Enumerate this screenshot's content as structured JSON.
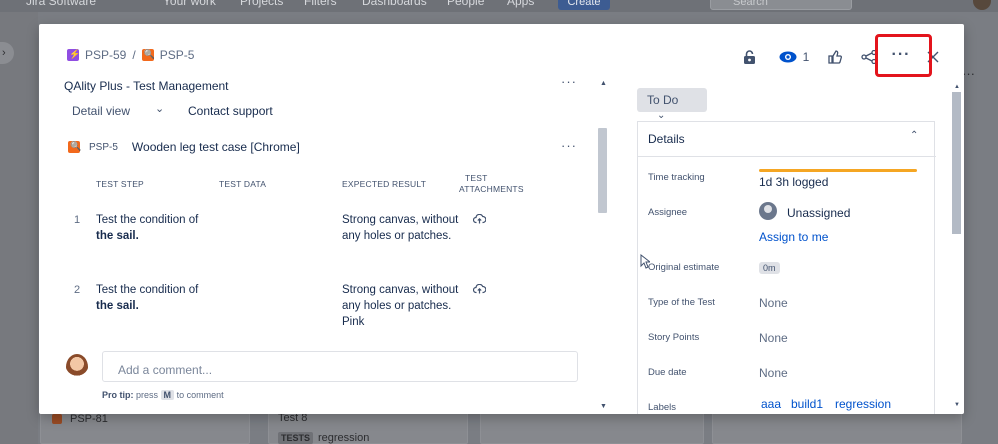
{
  "background": {
    "nav_items": [
      "Your work",
      "Projects",
      "Filters",
      "Dashboards",
      "People",
      "Apps"
    ],
    "app_name": "Jira Software",
    "create_label": "Create",
    "search_placeholder": "Search",
    "bottom_left_key": "PSP-81",
    "bottom_mid_text": "Test 8",
    "bottom_mid_tag": "TESTS",
    "bottom_mid_tag_value": "regression"
  },
  "modal": {
    "breadcrumb": {
      "parent_key": "PSP-59",
      "separator": "/",
      "current_key": "PSP-5"
    },
    "actions": {
      "watchers_count": "1"
    },
    "app_panel": {
      "title": "QAlity Plus - Test Management",
      "detail_view_label": "Detail view",
      "contact_support_label": "Contact support",
      "test_key": "PSP-5",
      "test_name": "Wooden leg test case [Chrome]",
      "columns": [
        "TEST STEP",
        "TEST DATA",
        "EXPECTED RESULT",
        "TEST",
        "ATTACHMENTS"
      ],
      "steps": [
        {
          "num": "1",
          "step_a": "Test the condition of",
          "step_b": "the sail.",
          "expected": "Strong canvas, without any holes or patches."
        },
        {
          "num": "2",
          "step_a": "Test the condition of",
          "step_b": "the sail.",
          "expected": "Strong canvas, without any holes or patches. Pink"
        }
      ]
    },
    "comment": {
      "placeholder": "Add a comment...",
      "protip_bold": "Pro tip:",
      "protip_press": "press",
      "protip_key": "M",
      "protip_rest": "to comment"
    },
    "status_label": "To Do",
    "details": {
      "heading": "Details",
      "time_tracking_label": "Time tracking",
      "time_tracking_value": "1d 3h logged",
      "assignee_label": "Assignee",
      "assignee_value": "Unassigned",
      "assign_to_me": "Assign to me",
      "original_estimate_label": "Original estimate",
      "original_estimate_value": "0m",
      "type_label": "Type of the Test",
      "type_value": "None",
      "story_points_label": "Story Points",
      "story_points_value": "None",
      "due_date_label": "Due date",
      "due_date_value": "None",
      "labels_label": "Labels",
      "labels": [
        "aaa",
        "build1",
        "regression"
      ]
    }
  },
  "colors": {
    "accent": "#0052cc",
    "highlight": "#e3141c",
    "tracking_bar": "#f5a623"
  }
}
